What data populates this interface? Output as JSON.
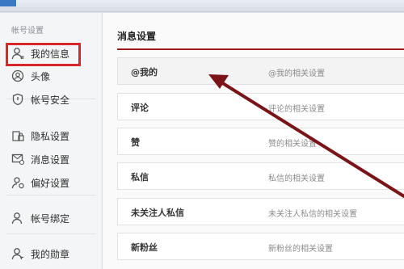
{
  "sidebar": {
    "section_title": "帐号设置",
    "items": [
      {
        "label": "我的信息",
        "icon": "user-icon"
      },
      {
        "label": "头像",
        "icon": "avatar-icon"
      },
      {
        "label": "帐号安全",
        "icon": "shield-icon"
      },
      {
        "label": "隐私设置",
        "icon": "lock-icon"
      },
      {
        "label": "消息设置",
        "icon": "message-icon"
      },
      {
        "label": "偏好设置",
        "icon": "preference-icon"
      },
      {
        "label": "帐号绑定",
        "icon": "bind-user-icon"
      },
      {
        "label": "我的勋章",
        "icon": "medal-icon"
      }
    ]
  },
  "main": {
    "title": "消息设置",
    "rows": [
      {
        "label": "@我的",
        "desc": "@我的相关设置"
      },
      {
        "label": "评论",
        "desc": "评论的相关设置"
      },
      {
        "label": "赞",
        "desc": "赞的相关设置"
      },
      {
        "label": "私信",
        "desc": "私信的相关设置"
      },
      {
        "label": "未关注人私信",
        "desc": "未关注人私信的相关设置"
      },
      {
        "label": "新粉丝",
        "desc": "新粉丝的相关设置"
      }
    ]
  },
  "colors": {
    "highlight_box": "#d8262b",
    "arrow": "#7a1418",
    "title_rule": "#a3191b"
  }
}
